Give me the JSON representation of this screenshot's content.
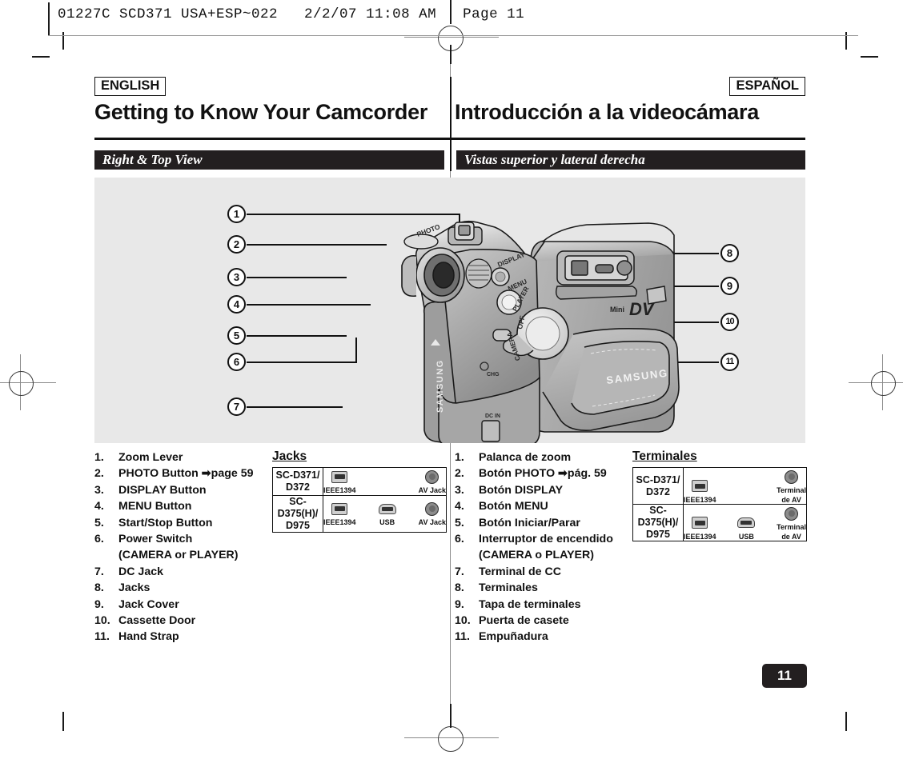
{
  "print_header": "01227C SCD371 USA+ESP~022   2/2/07 11:08 AM   Page 11",
  "languages": {
    "english": "ENGLISH",
    "spanish": "ESPAÑOL"
  },
  "titles": {
    "english": "Getting to Know Your Camcorder",
    "spanish": "Introducción a la videocámara"
  },
  "section_bars": {
    "english": "Right & Top View",
    "spanish": "Vistas superior y lateral derecha"
  },
  "diagram": {
    "callouts_left": [
      "1",
      "2",
      "3",
      "4",
      "5",
      "6",
      "7"
    ],
    "callouts_right": [
      "8",
      "9",
      "10",
      "11"
    ],
    "brand_label": "SAMSUNG",
    "format_label": "MiniDV",
    "control_labels": [
      "PHOTO",
      "DISPLAY",
      "MENU",
      "PLAYER",
      "OFF",
      "CAMERA",
      "CHG",
      "DC IN"
    ]
  },
  "list_english": [
    {
      "num": "1.",
      "text": "Zoom Lever"
    },
    {
      "num": "2.",
      "text": "PHOTO Button ➡page 59"
    },
    {
      "num": "3.",
      "text": "DISPLAY Button"
    },
    {
      "num": "4.",
      "text": "MENU Button"
    },
    {
      "num": "5.",
      "text": "Start/Stop Button"
    },
    {
      "num": "6.",
      "text": "Power Switch",
      "sub": "(CAMERA or PLAYER)"
    },
    {
      "num": "7.",
      "text": "DC Jack"
    },
    {
      "num": "8.",
      "text": "Jacks"
    },
    {
      "num": "9.",
      "text": "Jack Cover"
    },
    {
      "num": "10.",
      "text": "Cassette Door"
    },
    {
      "num": "11.",
      "text": "Hand Strap"
    }
  ],
  "list_spanish": [
    {
      "num": "1.",
      "text": "Palanca de zoom"
    },
    {
      "num": "2.",
      "text": "Botón PHOTO ➡pág. 59"
    },
    {
      "num": "3.",
      "text": "Botón DISPLAY"
    },
    {
      "num": "4.",
      "text": "Botón MENU"
    },
    {
      "num": "5.",
      "text": "Botón Iniciar/Parar"
    },
    {
      "num": "6.",
      "text": "Interruptor de encendido",
      "sub": "(CAMERA o PLAYER)"
    },
    {
      "num": "7.",
      "text": "Terminal de CC"
    },
    {
      "num": "8.",
      "text": "Terminales"
    },
    {
      "num": "9.",
      "text": "Tapa de terminales"
    },
    {
      "num": "10.",
      "text": "Puerta de casete"
    },
    {
      "num": "11.",
      "text": "Empuñadura"
    }
  ],
  "table_english": {
    "title": "Jacks",
    "rows": [
      {
        "model_line1": "SC-D371/",
        "model_line2": "D372",
        "ports": [
          {
            "icon": "ieee1394-icon",
            "label": "IEEE1394"
          },
          {
            "icon": "av-jack-icon",
            "label": "AV Jack"
          }
        ]
      },
      {
        "model_line1": "SC-",
        "model_line2": "D375(H)/",
        "model_line3": "D975",
        "ports": [
          {
            "icon": "ieee1394-icon",
            "label": "IEEE1394"
          },
          {
            "icon": "usb-icon",
            "label": "USB"
          },
          {
            "icon": "av-jack-icon",
            "label": "AV Jack"
          }
        ]
      }
    ]
  },
  "table_spanish": {
    "title": "Terminales",
    "rows": [
      {
        "model_line1": "SC-D371/",
        "model_line2": "D372",
        "ports": [
          {
            "icon": "ieee1394-icon",
            "label": "IEEE1394"
          },
          {
            "icon": "av-jack-icon",
            "label": "Terminal",
            "label2": "de AV"
          }
        ]
      },
      {
        "model_line1": "SC-",
        "model_line2": "D375(H)/",
        "model_line3": "D975",
        "ports": [
          {
            "icon": "ieee1394-icon",
            "label": "IEEE1394"
          },
          {
            "icon": "usb-icon",
            "label": "USB"
          },
          {
            "icon": "av-jack-icon",
            "label": "Terminal",
            "label2": "de AV"
          }
        ]
      }
    ]
  },
  "page_number": "11",
  "colors": {
    "bar": "#231f20",
    "diagram_bg": "#e8e8e8",
    "text": "#111111"
  }
}
